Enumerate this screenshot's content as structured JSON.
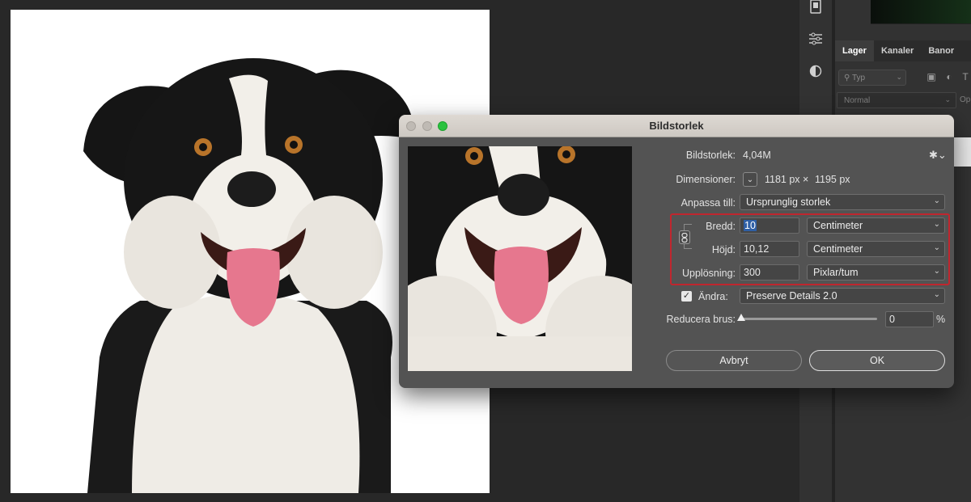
{
  "dialog": {
    "title": "Bildstorlek",
    "image_size_label": "Bildstorlek:",
    "image_size_value": "4,04M",
    "dimensions_label": "Dimensioner:",
    "dimensions_width": "1181 px",
    "dimensions_separator": "×",
    "dimensions_height": "1195 px",
    "fit_to_label": "Anpassa till:",
    "fit_to_value": "Ursprunglig storlek",
    "width_label": "Bredd:",
    "width_value": "10",
    "width_unit": "Centimeter",
    "height_label": "Höjd:",
    "height_value": "10,12",
    "height_unit": "Centimeter",
    "resolution_label": "Upplösning:",
    "resolution_value": "300",
    "resolution_unit": "Pixlar/tum",
    "resample_label": "Ändra:",
    "resample_checked": true,
    "resample_value": "Preserve Details 2.0",
    "reduce_noise_label": "Reducera brus:",
    "reduce_noise_value": "0",
    "reduce_noise_unit": "%",
    "reduce_noise_level": 0,
    "cancel_label": "Avbryt",
    "ok_label": "OK"
  },
  "layers_panel": {
    "tabs": [
      "Lager",
      "Kanaler",
      "Banor"
    ],
    "active_tab": "Lager",
    "filter_placeholder": "Typ",
    "blend_mode": "Normal",
    "opacity_label_partial": "Op"
  },
  "colors": {
    "dialog_bg": "#535353",
    "highlight_box": "#c0262e",
    "zoom_button": "#2ac23f",
    "app_bg": "#282828"
  }
}
